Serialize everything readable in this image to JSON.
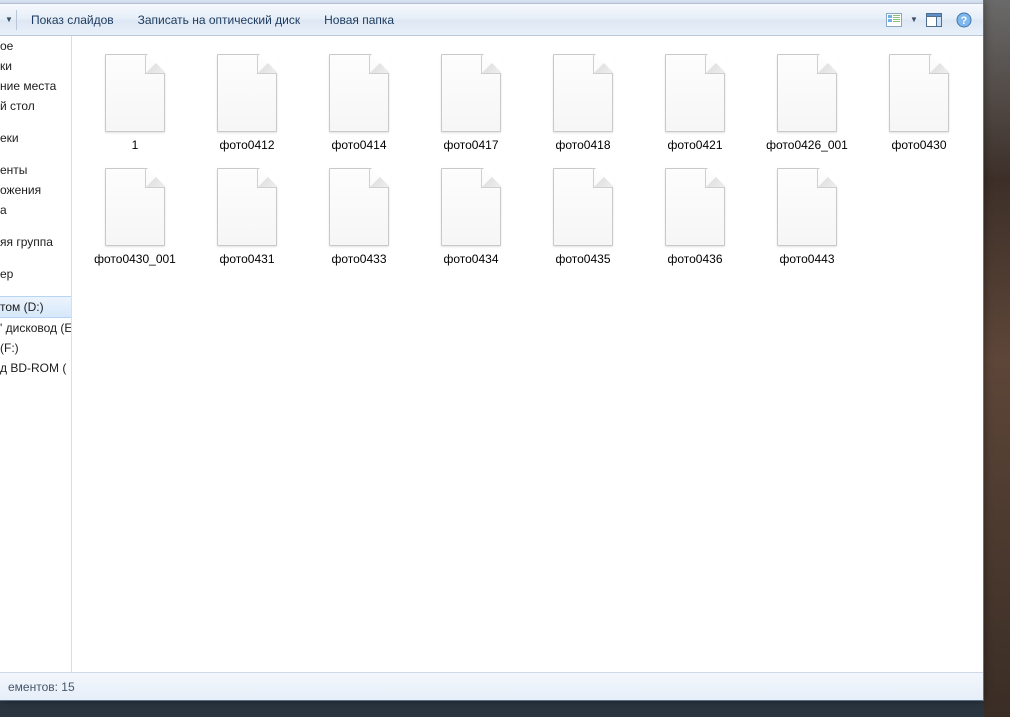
{
  "toolbar": {
    "slideshow": "Показ слайдов",
    "burn": "Записать на оптический диск",
    "new_folder": "Новая папка"
  },
  "sidebar": {
    "items": [
      "ое",
      "ки",
      "ние места",
      "й стол"
    ],
    "libs": [
      "еки"
    ],
    "user": [
      "енты",
      "ожения",
      "а"
    ],
    "homegroup": [
      "яя группа"
    ],
    "computer": [
      "ер"
    ],
    "drives": [
      "том (D:)",
      "' дисковод (E",
      "(F:)",
      "д BD-ROM ("
    ]
  },
  "files": [
    "1",
    "фото0412",
    "фото0414",
    "фото0417",
    "фото0418",
    "фото0421",
    "фото0426_001",
    "фото0430",
    "фото0430_001",
    "фото0431",
    "фото0433",
    "фото0434",
    "фото0435",
    "фото0436",
    "фото0443"
  ],
  "status": {
    "count_label": "ементов: 15"
  }
}
